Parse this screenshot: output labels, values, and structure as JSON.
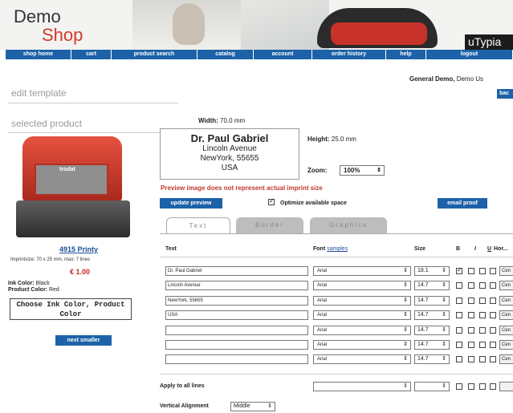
{
  "brand": {
    "demo": "Demo",
    "shop": "Shop",
    "utypia": "uTypia"
  },
  "nav": [
    {
      "label": "shop home",
      "w": 82
    },
    {
      "label": "cart",
      "w": 50
    },
    {
      "label": "product search",
      "w": 107
    },
    {
      "label": "catalog",
      "w": 70
    },
    {
      "label": "account",
      "w": 73
    },
    {
      "label": "order history",
      "w": 92
    },
    {
      "label": "help",
      "w": 50
    },
    {
      "label": "logout",
      "w": 108
    }
  ],
  "user": {
    "name": "General Demo,",
    "extra": "Demo Us"
  },
  "back_button": "bac",
  "left": {
    "edit_template": "edit template",
    "selected_product": "selected product",
    "stamp_brand": "trodat",
    "product_name": "4915 Printy",
    "product_dims": "Imprintsize: 70 x 25 mm, max: 7 lines",
    "price": "€ 1.00",
    "ink_color_label": "Ink Color:",
    "ink_color_value": "Black",
    "product_color_label": "Product Color:",
    "product_color_value": "Red",
    "choose_button": "Choose Ink Color, Product Color",
    "next_smaller": "next smaller"
  },
  "editor": {
    "width_label": "Width:",
    "width_value": "70.0 mm",
    "height_label": "Height:",
    "height_value": "25.0 mm",
    "zoom_label": "Zoom:",
    "zoom_value": "100%",
    "preview": {
      "name": "Dr. Paul Gabriel",
      "line1": "Lincoln Avenue",
      "line2": "NewYork, 55655",
      "line3": "USA"
    },
    "warning": "Preview image does not represent actual imprint size",
    "update_preview": "update preview",
    "optimize_label": "Optimize available space",
    "optimize_checked": true,
    "email_proof": "email proof"
  },
  "tabs": [
    {
      "label": "Text",
      "active": true
    },
    {
      "label": "Border",
      "active": false
    },
    {
      "label": "Graphics",
      "active": false
    }
  ],
  "columns": {
    "text": "Text",
    "font": "Font",
    "samples": "samples",
    "size": "Size",
    "bold": "B",
    "italic": "I",
    "underline": "U",
    "align": "Hor..."
  },
  "rows": [
    {
      "text": "Dr. Paul Gabriel",
      "font": "Arial",
      "size": "18.1",
      "bold": true,
      "align": "Cen"
    },
    {
      "text": "Lincoln Avenue",
      "font": "Arial",
      "size": "14.7",
      "bold": false,
      "align": "Cen"
    },
    {
      "text": "NewYork, 55655",
      "font": "Arial",
      "size": "14.7",
      "bold": false,
      "align": "Cen"
    },
    {
      "text": "USA",
      "font": "Arial",
      "size": "14.7",
      "bold": false,
      "align": "Cen"
    },
    {
      "text": "",
      "font": "Arial",
      "size": "14.7",
      "bold": false,
      "align": "Cen"
    },
    {
      "text": "",
      "font": "Arial",
      "size": "14.7",
      "bold": false,
      "align": "Cen"
    },
    {
      "text": "",
      "font": "Arial",
      "size": "14.7",
      "bold": false,
      "align": "Cen"
    }
  ],
  "apply_all": {
    "label": "Apply to all lines"
  },
  "vertical_alignment": {
    "label": "Vertical Alignment",
    "value": "Middle"
  }
}
